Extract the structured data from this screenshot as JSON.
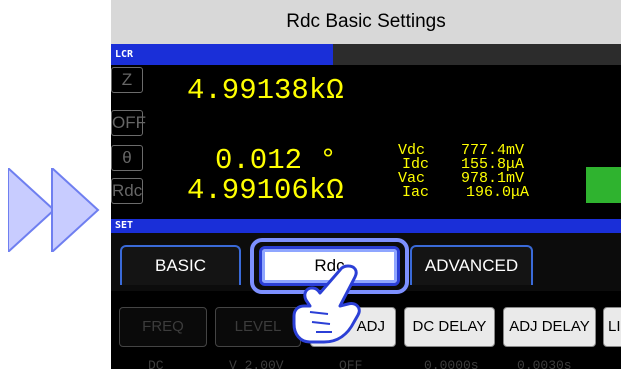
{
  "title": "Rdc Basic Settings",
  "lcr_label": "LCR",
  "set_label": "SET",
  "param_buttons": [
    "Z",
    "OFF",
    "θ",
    "Rdc"
  ],
  "primary": [
    {
      "value": "4.99138kΩ"
    },
    {
      "value": "0.012 °"
    },
    {
      "value": "4.99106kΩ"
    }
  ],
  "monitor": [
    {
      "label": "Vdc",
      "value": "777.4mV"
    },
    {
      "label": "Idc",
      "value": "155.8μA"
    },
    {
      "label": "Vac",
      "value": "978.1mV"
    },
    {
      "label": "Iac",
      "value": "196.0μA"
    }
  ],
  "tabs": {
    "basic": "BASIC",
    "rdc": "Rdc",
    "advanced": "ADVANCED"
  },
  "settings": {
    "freq": "FREQ",
    "level": "LEVEL",
    "temp_adj": "EMP ADJ",
    "dc_delay": "DC DELAY",
    "adj_delay": "ADJ DELAY",
    "li": "LI"
  },
  "setting_values": {
    "freq": "DC",
    "level": "V 2.00V",
    "temp_adj": "OFF",
    "dc_delay": "0.0000s",
    "adj_delay": "0.0030s"
  },
  "colors": {
    "accent_blue": "#1a2fd8",
    "value_yellow": "#ffff00",
    "ok_green": "#2fb32f",
    "highlight": "#7d90ff"
  },
  "icons": {
    "arrow": "double-right-arrow-icon",
    "pointer": "pointing-hand-icon"
  }
}
